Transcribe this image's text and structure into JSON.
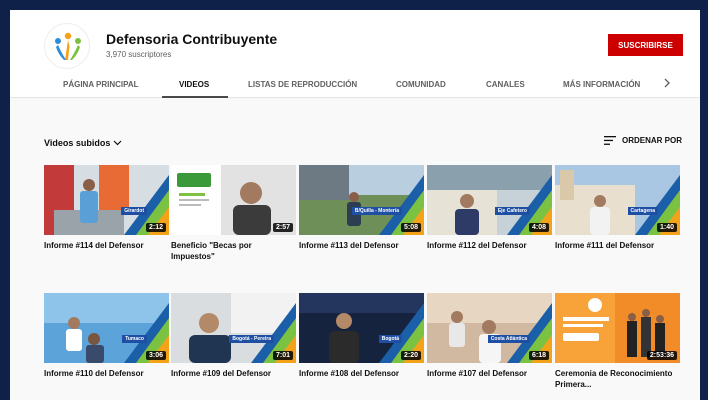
{
  "channel": {
    "name": "Defensoria Contribuyente",
    "subscribers": "3,970 suscriptores",
    "subscribe_label": "SUSCRIBIRSE"
  },
  "tabs": [
    {
      "label": "PÁGINA PRINCIPAL",
      "active": false
    },
    {
      "label": "VIDEOS",
      "active": true
    },
    {
      "label": "LISTAS DE REPRODUCCIÓN",
      "active": false
    },
    {
      "label": "COMUNIDAD",
      "active": false
    },
    {
      "label": "CANALES",
      "active": false
    },
    {
      "label": "MÁS INFORMACIÓN",
      "active": false
    }
  ],
  "section": {
    "uploads_label": "Videos subidos",
    "sort_label": "ORDENAR POR"
  },
  "videos": [
    {
      "title": "Informe #114 del Defensor",
      "duration": "2:12",
      "location": "Girardot"
    },
    {
      "title": "Beneficio \"Becas por Impuestos\"",
      "duration": "2:57",
      "location": ""
    },
    {
      "title": "Informe #113 del Defensor",
      "duration": "5:08",
      "location": "B/Quilla - Montería"
    },
    {
      "title": "Informe #112 del Defensor",
      "duration": "4:08",
      "location": "Eje Cafetero"
    },
    {
      "title": "Informe #111 del Defensor",
      "duration": "1:40",
      "location": "Cartagena"
    },
    {
      "title": "Informe #110 del Defensor",
      "duration": "3:06",
      "location": "Tumaco"
    },
    {
      "title": "Informe #109 del Defensor",
      "duration": "7:01",
      "location": "Bogotá - Pereira"
    },
    {
      "title": "Informe #108 del Defensor",
      "duration": "2:20",
      "location": "Bogotá"
    },
    {
      "title": "Informe #107 del Defensor",
      "duration": "6:18",
      "location": "Costa Atlántica"
    },
    {
      "title": "Ceremonia de Reconocimiento Primera...",
      "duration": "2:53:36",
      "location": ""
    }
  ],
  "colors": {
    "subscribe": "#cc0000",
    "background": "#0f2148",
    "page": "#f9f9f9"
  }
}
